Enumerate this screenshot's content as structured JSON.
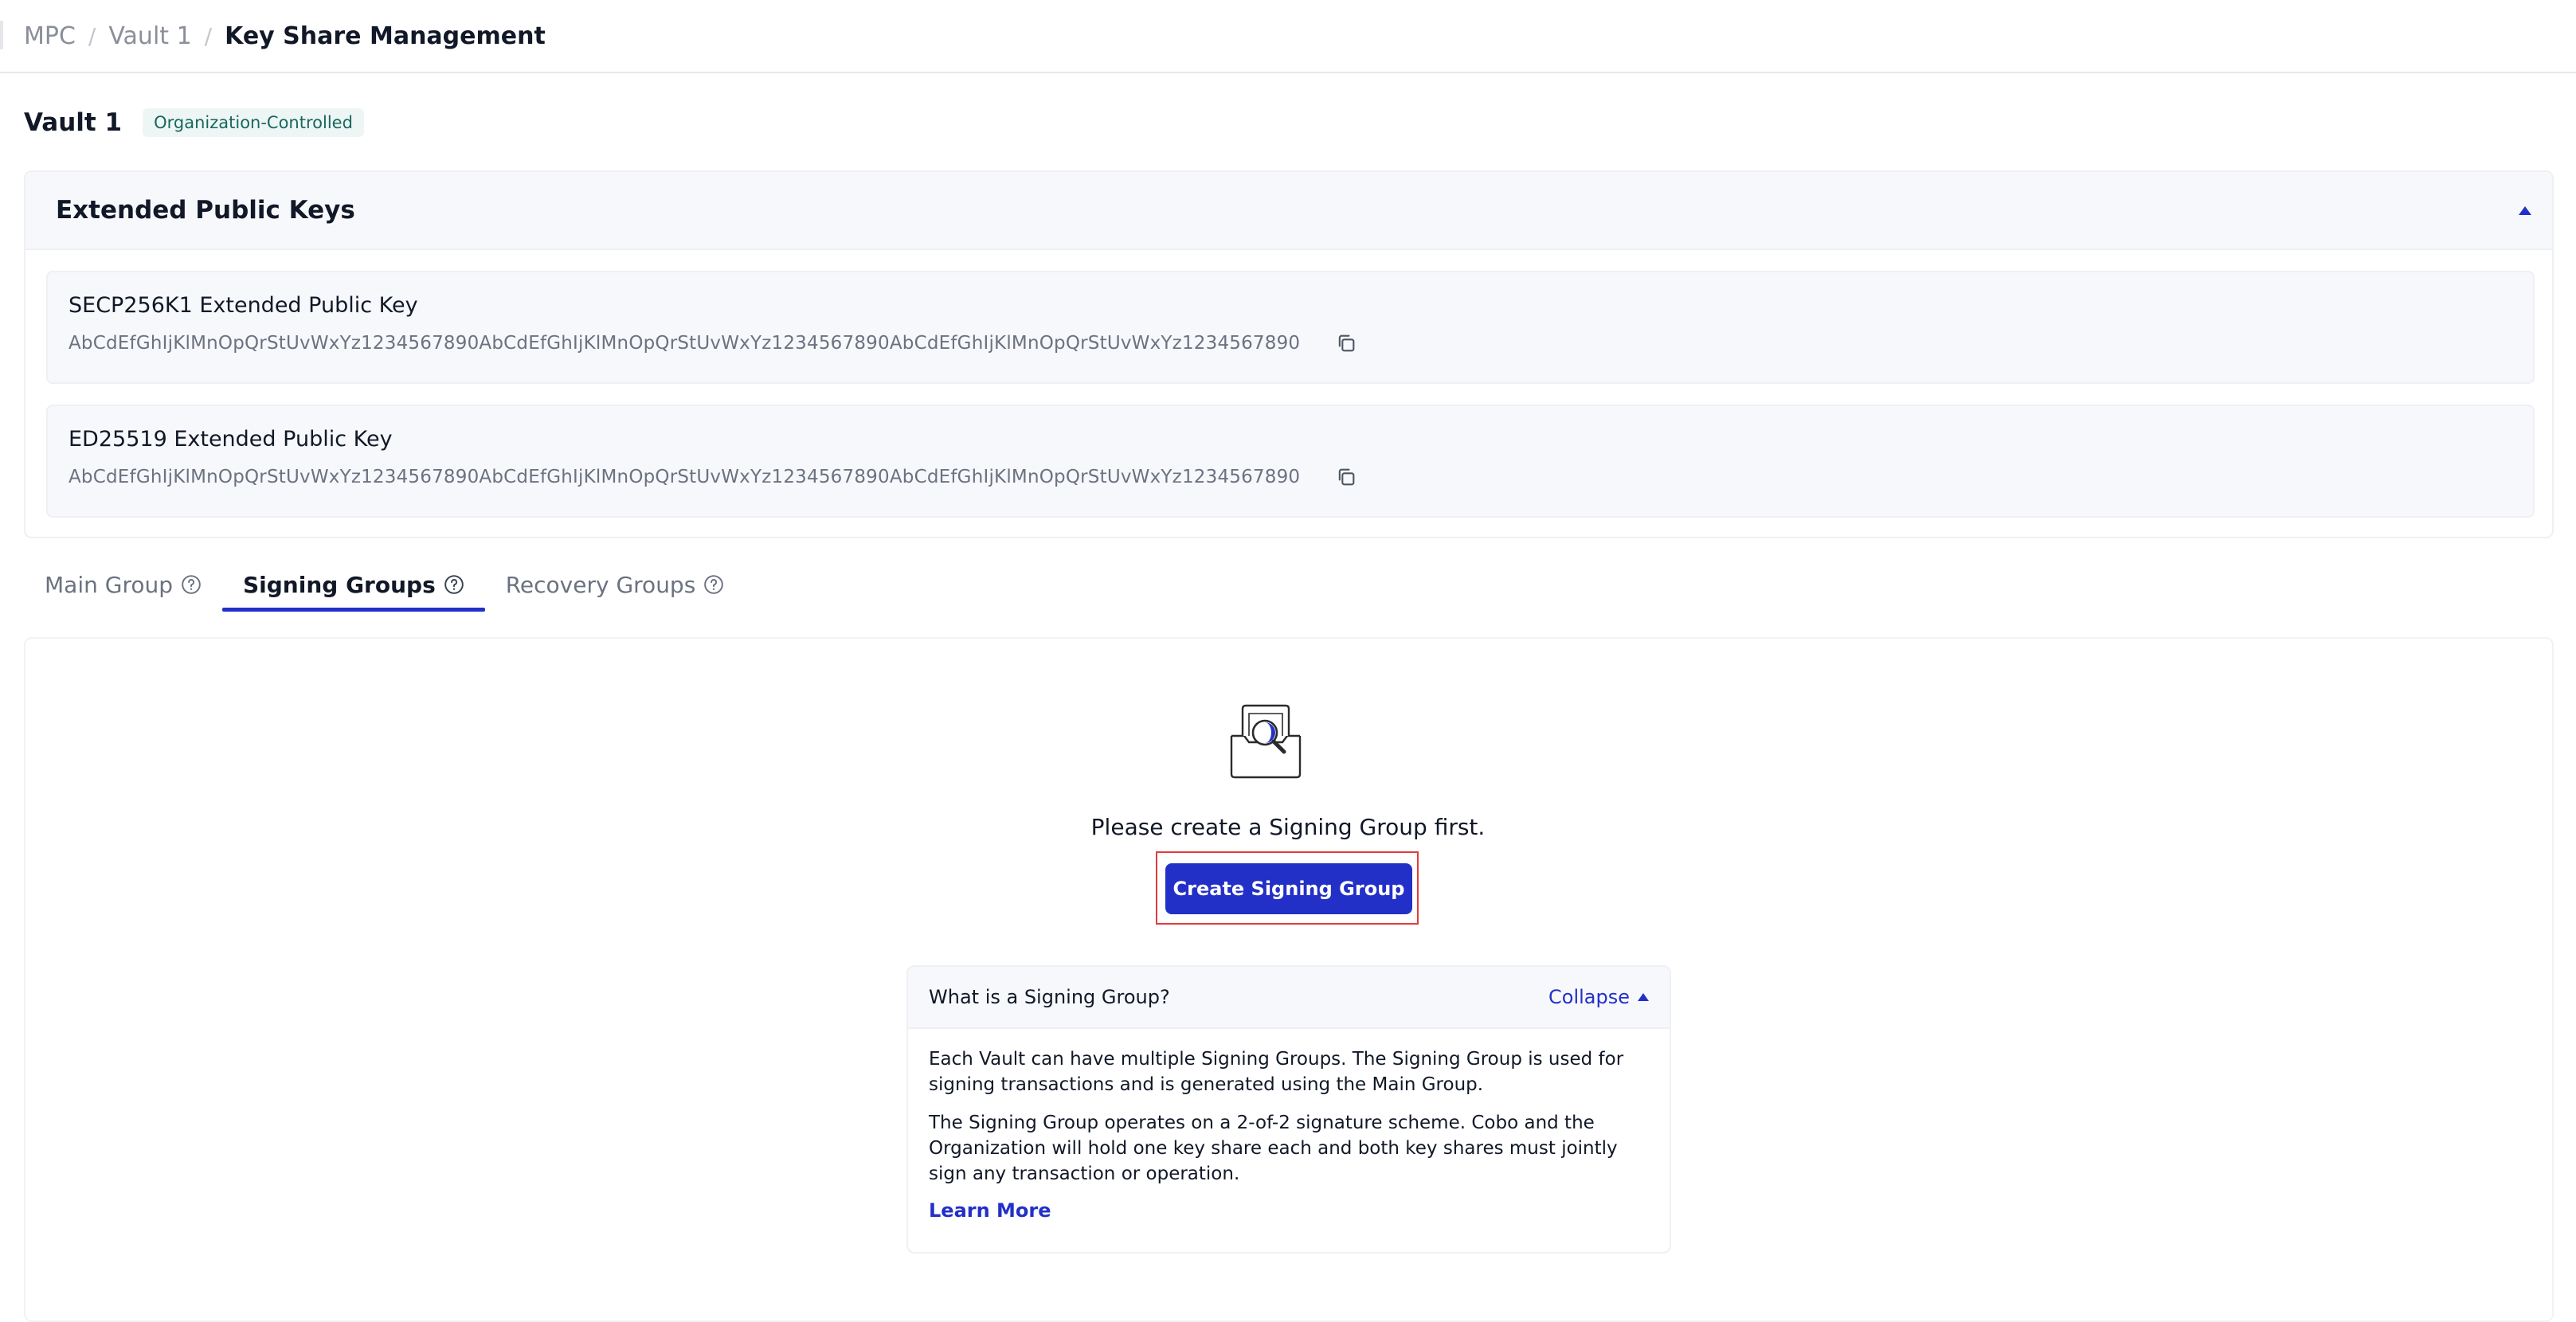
{
  "breadcrumb": {
    "items": [
      "MPC",
      "Vault 1"
    ],
    "current": "Key Share Management",
    "separator": "/"
  },
  "vault": {
    "name": "Vault 1",
    "badge": "Organization-Controlled"
  },
  "xpub_section": {
    "title": "Extended Public Keys",
    "keys": [
      {
        "title": "SECP256K1 Extended Public Key",
        "value": "AbCdEfGhIjKlMnOpQrStUvWxYz1234567890AbCdEfGhIjKlMnOpQrStUvWxYz1234567890AbCdEfGhIjKlMnOpQrStUvWxYz1234567890"
      },
      {
        "title": "ED25519 Extended Public Key",
        "value": "AbCdEfGhIjKlMnOpQrStUvWxYz1234567890AbCdEfGhIjKlMnOpQrStUvWxYz1234567890AbCdEfGhIjKlMnOpQrStUvWxYz1234567890"
      }
    ]
  },
  "tabs": [
    {
      "label": "Main Group",
      "active": false
    },
    {
      "label": "Signing Groups",
      "active": true
    },
    {
      "label": "Recovery Groups",
      "active": false
    }
  ],
  "empty_state": {
    "message": "Please create a Signing Group first.",
    "button_label": "Create Signing Group"
  },
  "info": {
    "question": "What is a Signing Group?",
    "collapse_label": "Collapse",
    "paragraph_1": "Each Vault can have multiple Signing Groups. The Signing Group is used for signing transactions and is generated using the Main Group.",
    "paragraph_2": "The Signing Group operates on a 2-of-2 signature scheme. Cobo and the Organization will hold one key share each and both key shares must jointly sign any transaction or operation.",
    "learn_more": "Learn More"
  },
  "colors": {
    "accent": "#2330c8",
    "badge_bg": "#eef6f5",
    "badge_text": "#17675f",
    "highlight_outline": "#e23b3b"
  }
}
